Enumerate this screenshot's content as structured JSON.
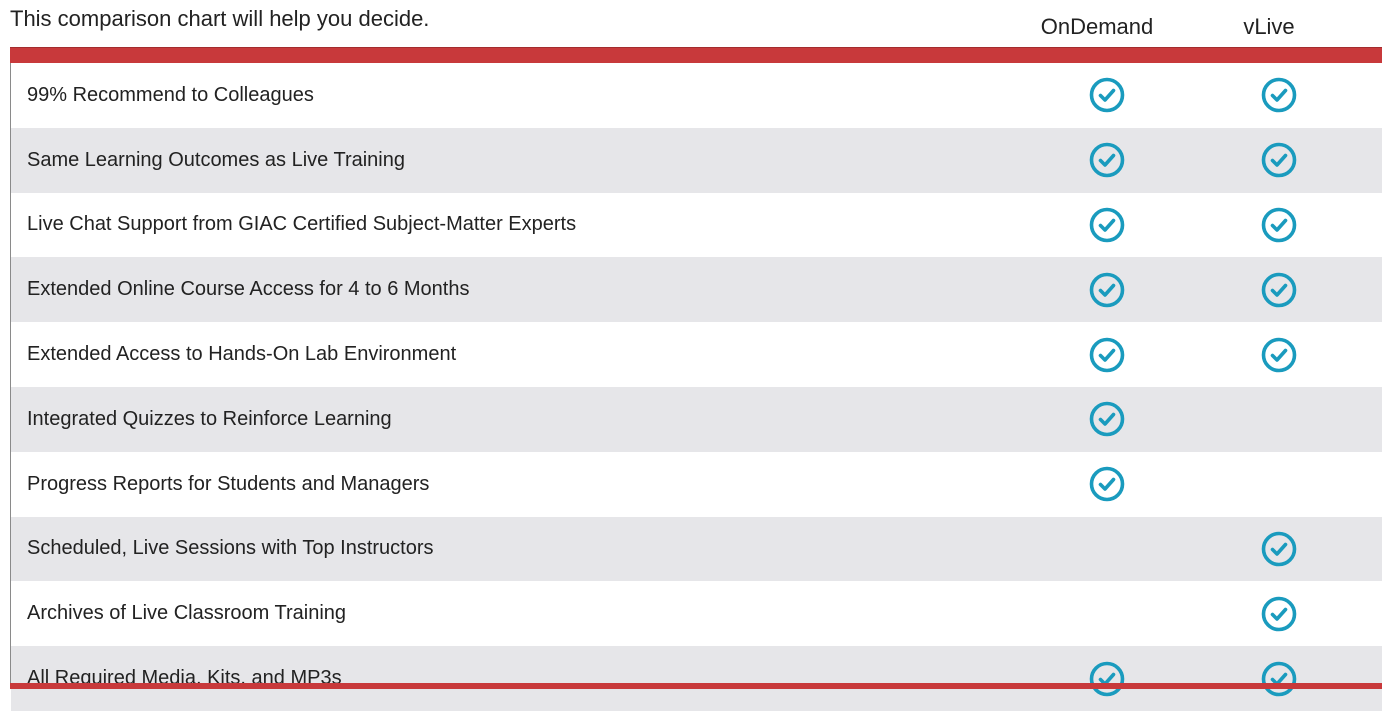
{
  "intro_text": "This comparison chart will help you decide.",
  "columns": [
    "OnDemand",
    "vLive"
  ],
  "colors": {
    "accent_bar": "#c8393b",
    "check": "#1a9bbe",
    "row_alt": "#e6e6e9"
  },
  "check_icon": "circle-check-icon",
  "rows": [
    {
      "label": "99% Recommend to Colleagues",
      "ondemand": true,
      "vlive": true
    },
    {
      "label": "Same Learning Outcomes as Live Training",
      "ondemand": true,
      "vlive": true
    },
    {
      "label": "Live Chat Support from GIAC Certified Subject-Matter Experts",
      "ondemand": true,
      "vlive": true
    },
    {
      "label": "Extended Online Course Access for 4 to 6 Months",
      "ondemand": true,
      "vlive": true
    },
    {
      "label": "Extended Access to Hands-On Lab Environment",
      "ondemand": true,
      "vlive": true
    },
    {
      "label": "Integrated Quizzes to Reinforce Learning",
      "ondemand": true,
      "vlive": false
    },
    {
      "label": "Progress Reports for Students and Managers",
      "ondemand": true,
      "vlive": false
    },
    {
      "label": "Scheduled, Live Sessions with Top Instructors",
      "ondemand": false,
      "vlive": true
    },
    {
      "label": "Archives of Live Classroom Training",
      "ondemand": false,
      "vlive": true
    },
    {
      "label": "All Required Media, Kits, and MP3s",
      "ondemand": true,
      "vlive": true
    }
  ]
}
